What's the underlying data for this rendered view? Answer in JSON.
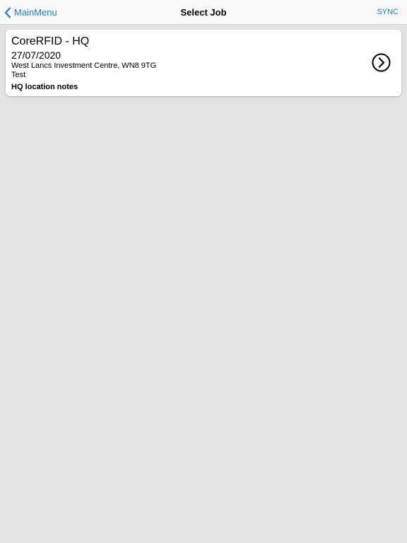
{
  "navbar": {
    "back_label": "MainMenu",
    "title": "Select Job",
    "sync_label": "SYNC",
    "accent_color": "#1a7cf5"
  },
  "jobs": [
    {
      "name": "CoreRFID - HQ",
      "date": "27/07/2020",
      "address": "West Lancs Investment Centre, WN8 9TG",
      "description": "Test",
      "notes": "HQ location notes",
      "open_icon": "chevron-right-circle-icon"
    }
  ]
}
